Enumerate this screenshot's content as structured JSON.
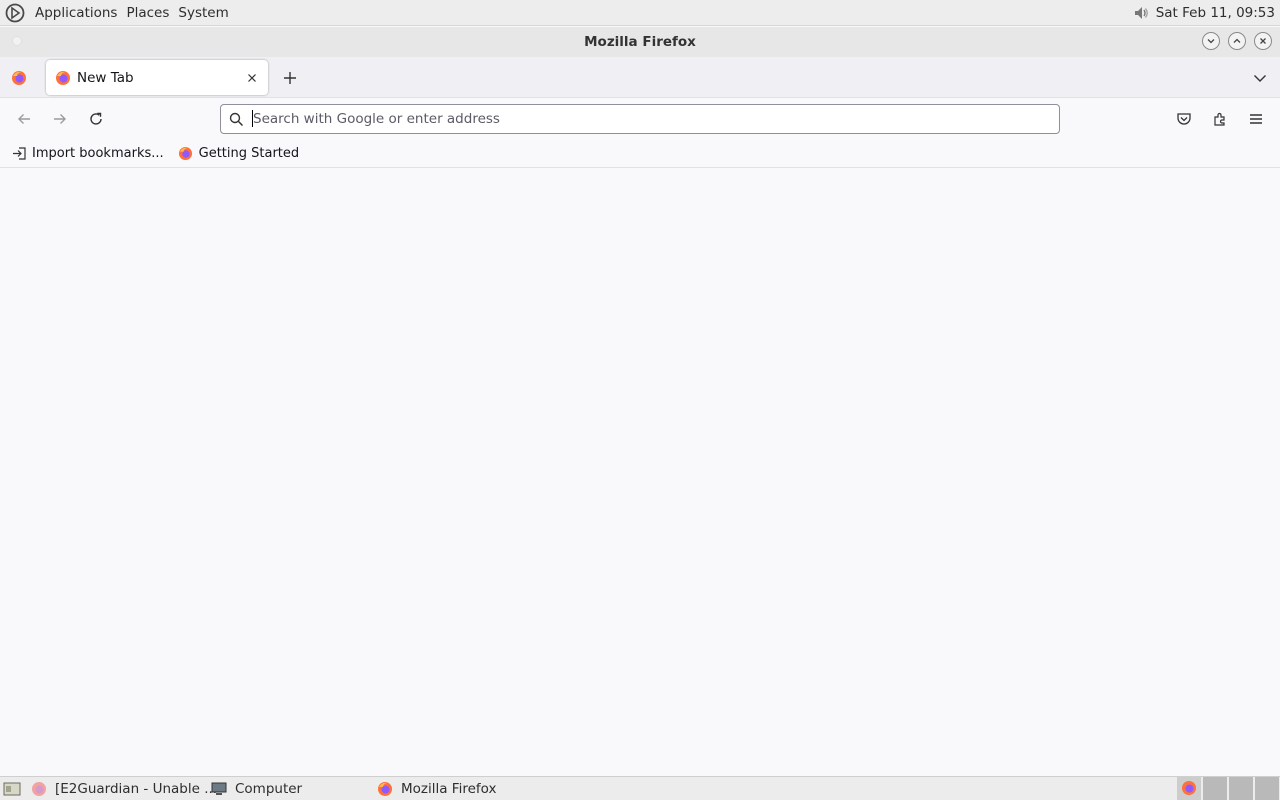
{
  "top_panel": {
    "menus": [
      "Applications",
      "Places",
      "System"
    ],
    "clock": "Sat Feb 11, 09:53",
    "icons": [
      "distro-logo-icon",
      "volume-icon"
    ]
  },
  "window": {
    "title": "Mozilla Firefox"
  },
  "tabs": [
    {
      "label": "New Tab",
      "icon": "firefox-icon"
    }
  ],
  "urlbar": {
    "placeholder": "Search with Google or enter address",
    "value": ""
  },
  "bookmarks": [
    {
      "label": "Import bookmarks...",
      "icon": "import-icon"
    },
    {
      "label": "Getting Started",
      "icon": "firefox-icon"
    }
  ],
  "taskbar": {
    "items": [
      {
        "label": "[E2Guardian - Unable ...",
        "icon": "firefox-icon"
      },
      {
        "label": "Computer",
        "icon": "computer-icon"
      },
      {
        "label": "Mozilla Firefox",
        "icon": "firefox-icon"
      }
    ],
    "workspaces": 4
  },
  "colors": {
    "firefox_orange": "#ff7139",
    "firefox_purple": "#9059ff",
    "panel_bg": "#ededed",
    "toolbar_bg": "#f9f9fb"
  }
}
